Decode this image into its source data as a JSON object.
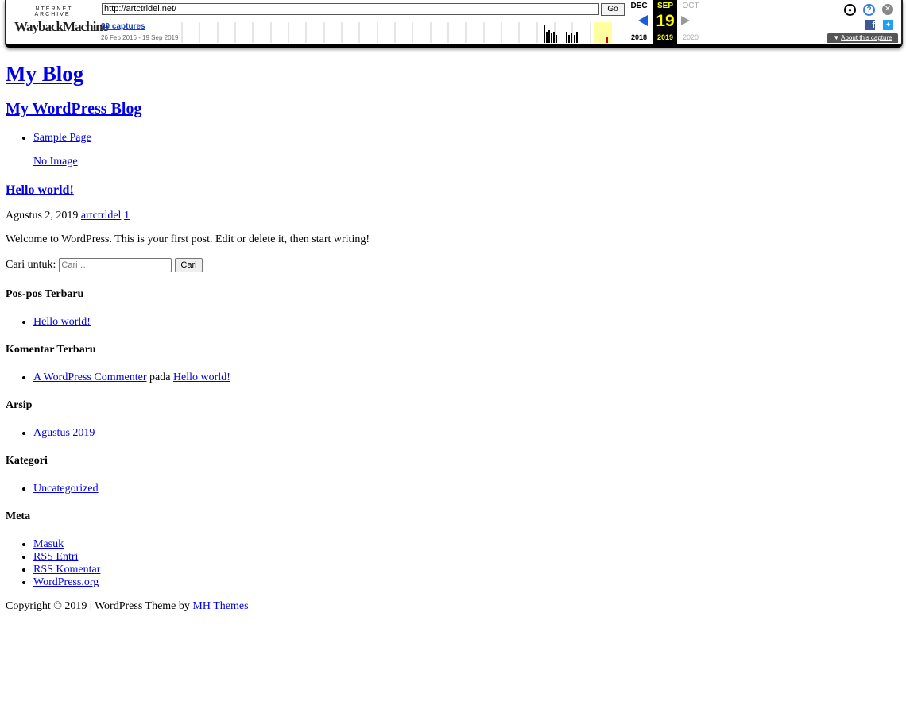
{
  "wayback": {
    "logo_top": "INTERNET ARCHIVE",
    "logo_wayback": "Wayback",
    "logo_machine": "Machine",
    "url": "http://artctrldel.net/",
    "go": "Go",
    "captures": "30 captures",
    "range": "26 Feb 2016 - 19 Sep 2019",
    "prev_month": "DEC",
    "prev_year": "2018",
    "cur_month": "SEP",
    "cur_day": "19",
    "cur_year": "2019",
    "next_month": "OCT",
    "next_year": "2020",
    "about": "About this capture",
    "icons": [
      "user-icon",
      "help-icon",
      "close-icon",
      "facebook-icon",
      "twitter-icon"
    ]
  },
  "site": {
    "title": "My Blog",
    "description": "My WordPress Blog",
    "nav": [
      "Sample Page"
    ],
    "image_alt": "No Image"
  },
  "post": {
    "title": "Hello world!",
    "date": "Agustus 2, 2019",
    "author": "artctrldel",
    "comments": "1",
    "content": "Welcome to WordPress. This is your first post. Edit or delete it, then start writing!"
  },
  "search": {
    "label": "Cari untuk:",
    "placeholder": "Cari …",
    "button": "Cari"
  },
  "widgets": {
    "recent_posts": {
      "title": "Pos-pos Terbaru",
      "items": [
        "Hello world!"
      ]
    },
    "recent_comments": {
      "title": "Komentar Terbaru",
      "author": "A WordPress Commenter",
      "on": "pada",
      "post": "Hello world!"
    },
    "archives": {
      "title": "Arsip",
      "items": [
        "Agustus 2019"
      ]
    },
    "categories": {
      "title": "Kategori",
      "items": [
        "Uncategorized"
      ]
    },
    "meta": {
      "title": "Meta",
      "items": [
        "Masuk",
        "RSS Entri",
        "RSS Komentar",
        "WordPress.org"
      ]
    }
  },
  "footer": {
    "text": "Copyright © 2019 | WordPress Theme by",
    "link": "MH Themes"
  }
}
